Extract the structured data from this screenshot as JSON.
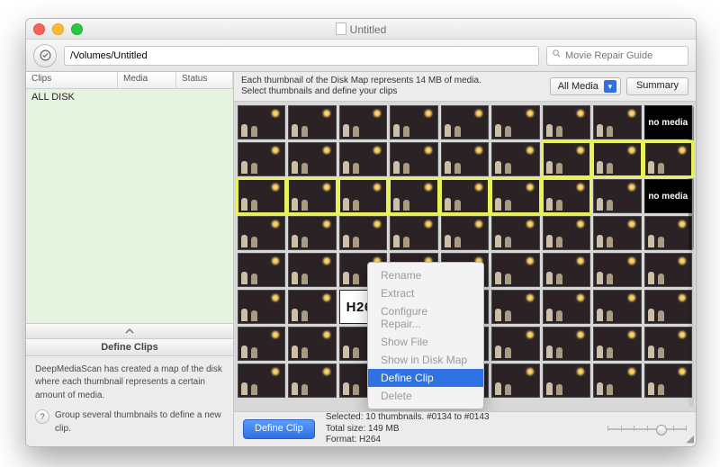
{
  "window": {
    "title": "Untitled"
  },
  "toolbar": {
    "path": "/Volumes/Untitled",
    "search_placeholder": "Movie Repair Guide"
  },
  "left": {
    "headers": {
      "clips": "Clips",
      "media": "Media",
      "status": "Status"
    },
    "list_item": "ALL DISK",
    "panel_title": "Define Clips",
    "panel_text": "DeepMediaScan has created a map of the disk where each thumbnail represents a certain amount of media.",
    "help_text": "Group several thumbnails to define a new clip."
  },
  "right": {
    "instruction_l1": "Each thumbnail of the Disk Map represents 14 MB of media.",
    "instruction_l2": "Select thumbnails and define your clips",
    "media_filter": "All Media",
    "summary_label": "Summary"
  },
  "thumbs": {
    "h264_label": "H264",
    "nomedia_label": "no media",
    "selected_indices": [
      15,
      16,
      17,
      18,
      19,
      20,
      21,
      22,
      23,
      24
    ],
    "special": {
      "8": "nomedia",
      "26": "nomedia",
      "47": "h264"
    }
  },
  "context_menu": {
    "rename": "Rename",
    "extract": "Extract",
    "configure": "Configure Repair...",
    "show_file": "Show File",
    "show_in_map": "Show in Disk Map",
    "define_clip": "Define Clip",
    "delete": "Delete"
  },
  "footer": {
    "define_button": "Define Clip",
    "line1": "Selected: 10 thumbnails. #0134 to #0143",
    "line2": "Total size: 149 MB",
    "line3": "Format: H264"
  }
}
